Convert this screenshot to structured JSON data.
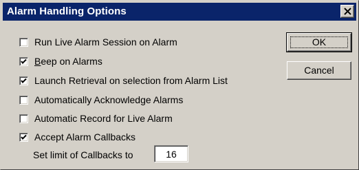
{
  "window": {
    "title": "Alarm Handling Options"
  },
  "options": [
    {
      "label": "Run Live Alarm Session on Alarm",
      "checked": false
    },
    {
      "label_u": "B",
      "label_rest": "eep on Alarms",
      "checked": true
    },
    {
      "label": "Launch Retrieval on selection from Alarm List",
      "checked": true
    },
    {
      "label": "Automatically Acknowledge Alarms",
      "checked": false
    },
    {
      "label": "Automatic Record for Live Alarm",
      "checked": false
    },
    {
      "label": "Accept Alarm Callbacks",
      "checked": true
    }
  ],
  "callbacks": {
    "limit_label": "Set limit of Callbacks to",
    "limit_value": "16"
  },
  "buttons": {
    "ok_label": "OK",
    "cancel_label": "Cancel"
  },
  "colors": {
    "titlebar": "#0a246a",
    "face": "#d4d0c8"
  },
  "icons": {
    "close": "close-icon",
    "check": "check-icon"
  }
}
